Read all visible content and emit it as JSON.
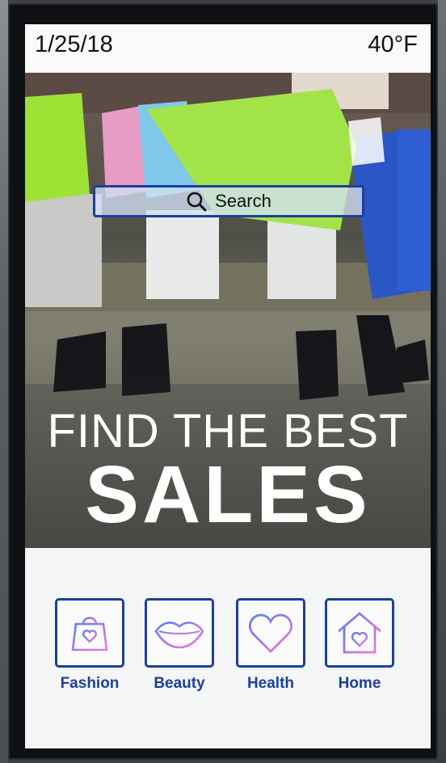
{
  "status": {
    "date": "1/25/18",
    "temperature": "40°F"
  },
  "search": {
    "label": "Search",
    "icon": "search-icon"
  },
  "hero": {
    "headline_top": "FIND THE BEST",
    "headline_bottom": "SALES"
  },
  "categories": [
    {
      "label": "Fashion",
      "icon": "shopping-bag-heart-icon"
    },
    {
      "label": "Beauty",
      "icon": "lips-icon"
    },
    {
      "label": "Health",
      "icon": "heart-icon"
    },
    {
      "label": "Home",
      "icon": "house-heart-icon"
    }
  ],
  "colors": {
    "accent": "#1d3f9a",
    "icon_gradient_start": "#5b7cf2",
    "icon_gradient_end": "#f07ad8"
  }
}
